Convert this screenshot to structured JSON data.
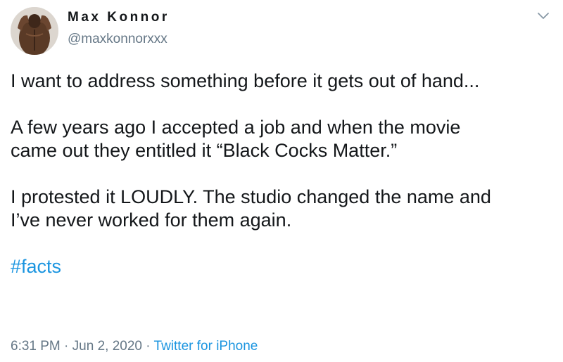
{
  "user": {
    "display_name": "Max Konnor",
    "handle": "@maxkonnorxxx",
    "avatar_icon": "profile-photo"
  },
  "menu_icon": "chevron-down-icon",
  "tweet": {
    "line1": "I want to address something before it gets out of hand...",
    "line2": "A few years ago I accepted a job and when the movie",
    "line3": "came out they entitled it “Black Cocks Matter.”",
    "line4": "I protested it LOUDLY.  The studio changed the name and",
    "line5": "I’ve never worked for them again.",
    "hashtag": "#facts"
  },
  "meta": {
    "time": "6:31 PM",
    "date": "Jun 2, 2020",
    "separator": "·",
    "source": "Twitter for iPhone"
  },
  "colors": {
    "text": "#14171a",
    "secondary": "#657786",
    "link": "#1b95e0"
  }
}
